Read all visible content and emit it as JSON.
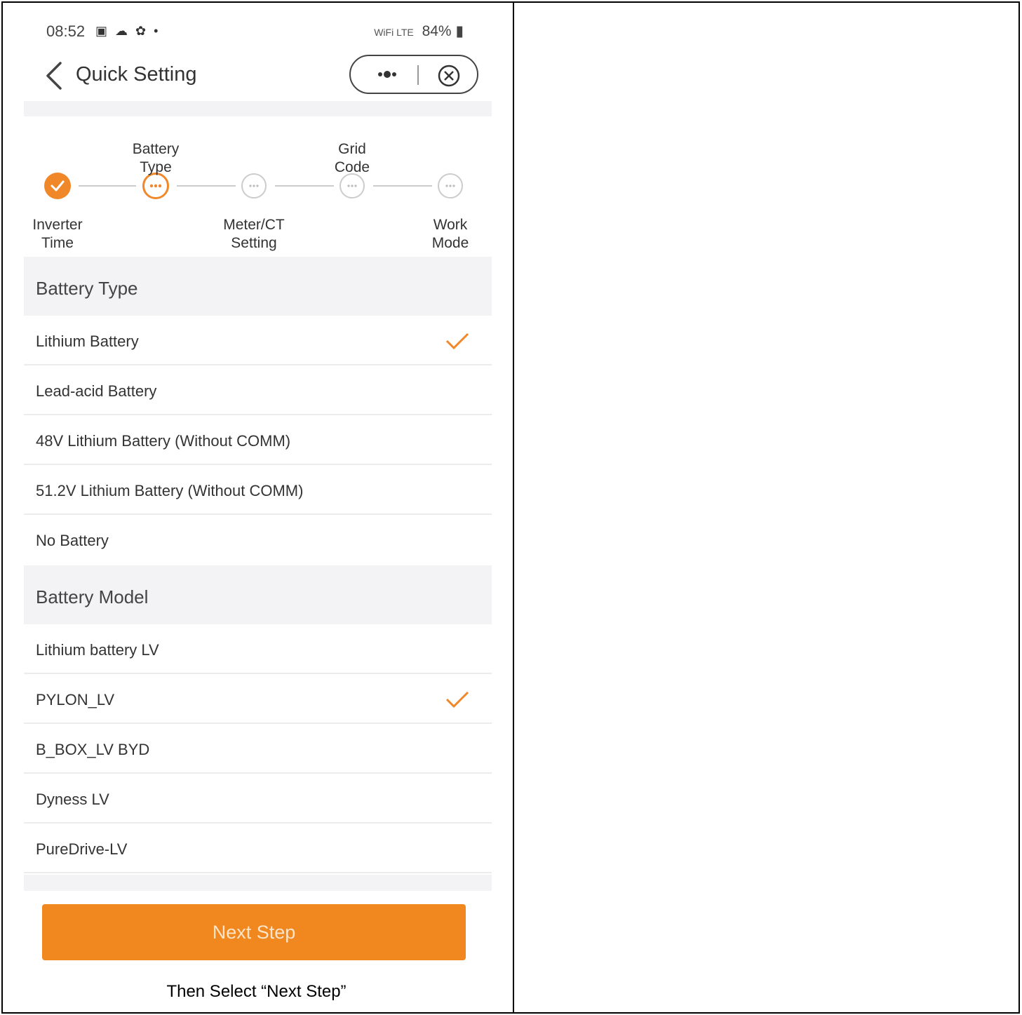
{
  "status_bar": {
    "time": "08:52",
    "left_icons": "▣ ☁ ✿ •",
    "network": "WiFi LTE",
    "battery": "84%"
  },
  "header": {
    "title": "Quick Setting"
  },
  "stepper": {
    "steps": [
      {
        "label_line1": "Inverter",
        "label_line2": "Time",
        "state": "done"
      },
      {
        "label_line1": "Battery",
        "label_line2": "Type",
        "state": "active"
      },
      {
        "label_line1": "Meter/CT",
        "label_line2": "Setting",
        "state": "todo"
      },
      {
        "label_line1": "Grid",
        "label_line2": "Code",
        "state": "todo"
      },
      {
        "label_line1": "Work",
        "label_line2": "Mode",
        "state": "todo"
      }
    ]
  },
  "battery_type": {
    "heading": "Battery Type",
    "options": [
      {
        "label": "Lithium Battery",
        "selected": true
      },
      {
        "label": "Lead-acid Battery",
        "selected": false
      },
      {
        "label": "48V Lithium Battery (Without COMM)",
        "selected": false
      },
      {
        "label": "51.2V Lithium Battery (Without COMM)",
        "selected": false
      },
      {
        "label": "No Battery",
        "selected": false
      }
    ]
  },
  "battery_model": {
    "heading": "Battery Model",
    "options": [
      {
        "label": "Lithium battery LV",
        "selected": false
      },
      {
        "label": "PYLON_LV",
        "selected": true
      },
      {
        "label": "B_BOX_LV BYD",
        "selected": false
      },
      {
        "label": "Dyness LV",
        "selected": false
      },
      {
        "label": "PureDrive-LV",
        "selected": false
      }
    ]
  },
  "footer": {
    "next_label": "Next Step"
  },
  "caption": "Then Select “Next Step”",
  "colors": {
    "accent": "#f0882a",
    "section_bg": "#f3f3f5"
  }
}
